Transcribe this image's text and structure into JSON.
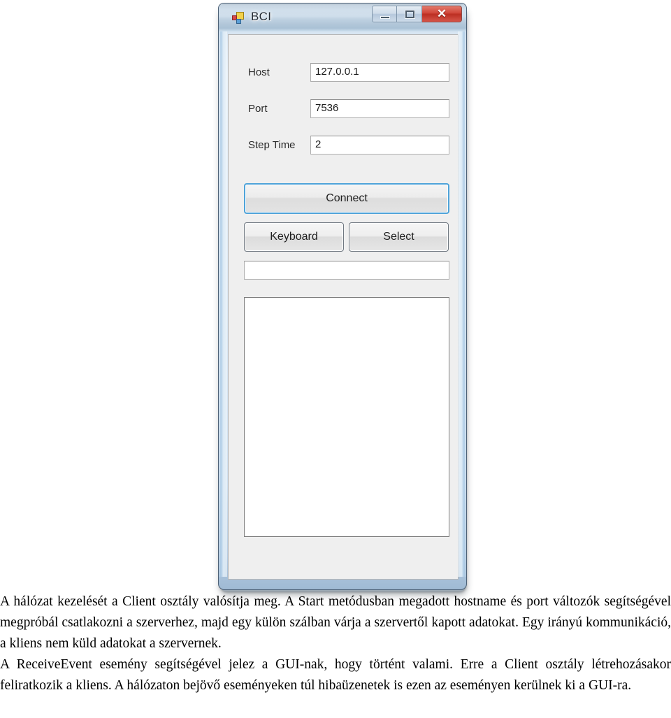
{
  "window": {
    "title": "BCI",
    "icon": "dotnet-app-icon",
    "controls": {
      "minimize_label": "—",
      "maximize_label": "□",
      "close_label": "✕"
    }
  },
  "form": {
    "fields": [
      {
        "label": "Host",
        "value": "127.0.0.1"
      },
      {
        "label": "Port",
        "value": "7536"
      },
      {
        "label": "Step Time",
        "value": "2"
      }
    ]
  },
  "buttons": {
    "connect": "Connect",
    "keyboard": "Keyboard",
    "select": "Select"
  },
  "status_box": {
    "value": ""
  },
  "log_box": {
    "value": ""
  },
  "document": {
    "paragraph_1": "A hálózat kezelését a Client osztály valósítja meg. A Start metódusban megadott hostname és port változók segítségével megpróbál csatlakozni a szerverhez, majd egy külön szálban várja a szervertől kapott adatokat. Egy irányú kommunikáció, a kliens nem küld adatokat a szervernek.",
    "paragraph_2": "A ReceiveEvent esemény segítségével jelez a GUI-nak, hogy történt valami. Erre a Client osztály létrehozásakor feliratkozik a kliens. A hálózaton bejövő eseményeken túl hibaüzenetek is ezen az eseményen kerülnek ki a GUI-ra."
  },
  "colors": {
    "accent_focus": "#4ea3d9",
    "close_button": "#d2493c",
    "client_background": "#efefef",
    "titlebar": "#c3d6e6"
  }
}
